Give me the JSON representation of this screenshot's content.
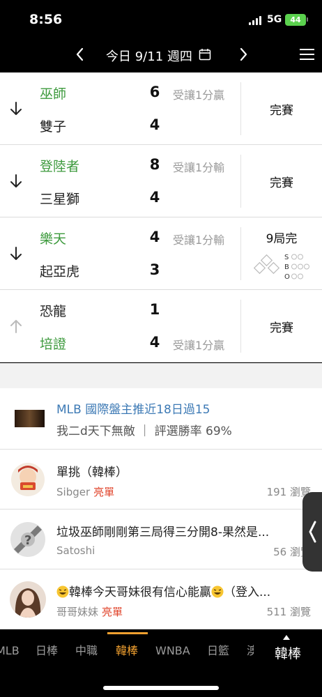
{
  "status_bar": {
    "time": "8:56",
    "network": "5G",
    "battery": "44"
  },
  "header": {
    "prev_label": "‹",
    "date": "今日 9/11 週四",
    "next_label": "›"
  },
  "games": [
    {
      "team1": "巫師",
      "score1": "6",
      "line1": "受讓1分贏",
      "team2": "雙子",
      "score2": "4",
      "line2": "",
      "status": "完賽",
      "fav": 1,
      "arrow": "down"
    },
    {
      "team1": "登陸者",
      "score1": "8",
      "line1": "受讓1分輸",
      "team2": "三星獅",
      "score2": "4",
      "line2": "",
      "status": "完賽",
      "fav": 1,
      "arrow": "down"
    },
    {
      "team1": "樂天",
      "score1": "4",
      "line1": "受讓1分輸",
      "team2": "起亞虎",
      "score2": "3",
      "line2": "",
      "status": "9局完",
      "fav": 1,
      "arrow": "down",
      "sbo": [
        "S",
        "B",
        "O"
      ]
    },
    {
      "team1": "恐龍",
      "score1": "1",
      "line1": "",
      "team2": "培證",
      "score2": "4",
      "line2": "受讓1分贏",
      "status": "完賽",
      "fav": 2,
      "arrow": "up"
    }
  ],
  "promo": {
    "title": "MLB 國際盤主推近18日過15",
    "subtitle": "我二d天下無敵 ｜ 評選勝率 69%"
  },
  "articles": [
    {
      "title": "單挑（韓棒）",
      "author": "Sibger",
      "tag": "亮單",
      "views": "191 瀏覽"
    },
    {
      "title": "垃圾巫師剛剛第三局得三分開8-果然是...",
      "author": "Satoshi",
      "tag": "",
      "views": "56 瀏覽"
    },
    {
      "title": "韓棒今天哥妹很有信心能贏",
      "title_suffix": "（登入...",
      "author": "哥哥妹妹",
      "tag": "亮單",
      "views": "511 瀏覽"
    }
  ],
  "tabs": [
    "MLB",
    "日棒",
    "中職",
    "韓棒",
    "WNBA",
    "日籃",
    "澳"
  ],
  "active_tab": "韓棒",
  "current_league": "韓棒",
  "colors": {
    "favorite": "#3d9a3d",
    "accent": "#f0a030",
    "link": "#3d7ab5",
    "tag": "#e0432a"
  }
}
